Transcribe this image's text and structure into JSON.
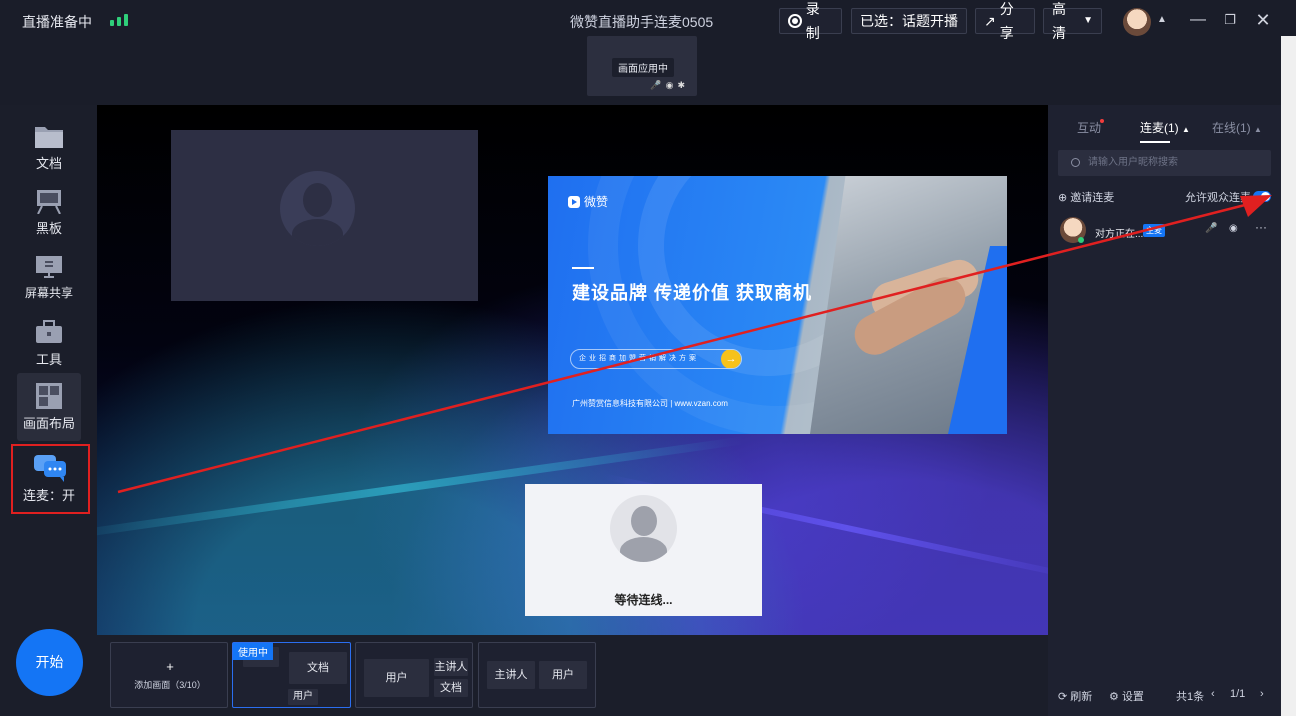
{
  "topbar": {
    "status": "直播准备中",
    "title": "微赞直播助手连麦0505",
    "record_label": "录制",
    "selected_label": "已选：话题开播",
    "share_label": "分享",
    "quality_label": "高清",
    "preview_label": "画面应用中"
  },
  "sidebar": {
    "items": [
      {
        "label": "文档",
        "icon": "folder-icon"
      },
      {
        "label": "黑板",
        "icon": "blackboard-icon"
      },
      {
        "label": "屏幕共享",
        "icon": "monitor-icon"
      },
      {
        "label": "工具",
        "icon": "toolbox-icon"
      },
      {
        "label": "画面布局",
        "icon": "layout-icon"
      },
      {
        "label": "连麦：开",
        "icon": "chat-bubbles-icon"
      }
    ],
    "start_label": "开始"
  },
  "slide": {
    "logo_text": "微赞",
    "headline": "建设品牌  传递价值  获取商机",
    "pill_text": "企业招商加盟营销解决方案",
    "footer": "广州赞赏信息科技有限公司 | www.vzan.com"
  },
  "waiting": {
    "label": "等待连线..."
  },
  "layouts": {
    "add_label": "+",
    "add_text": "添加画面（3/10）",
    "using_tag": "使用中",
    "card2": {
      "a": "文档",
      "b": "用户"
    },
    "card3": {
      "a": "用户",
      "b": "主讲人",
      "c": "文档"
    },
    "card4": {
      "a": "主讲人",
      "b": "用户"
    }
  },
  "right_panel": {
    "tabs": [
      {
        "label": "互动"
      },
      {
        "label": "连麦(1)"
      },
      {
        "label": "在线(1)"
      }
    ],
    "search_placeholder": "请输入用户昵称搜索",
    "invite_label": "邀请连麦",
    "allow_label": "允许观众连麦",
    "user": {
      "name": "对方正在...",
      "badge": "主麦"
    },
    "refresh_label": "刷新",
    "settings_label": "设置",
    "total_label": "共1条",
    "page_label": "1/1"
  },
  "colors": {
    "accent": "#1475f5",
    "annotation": "#e02020"
  }
}
